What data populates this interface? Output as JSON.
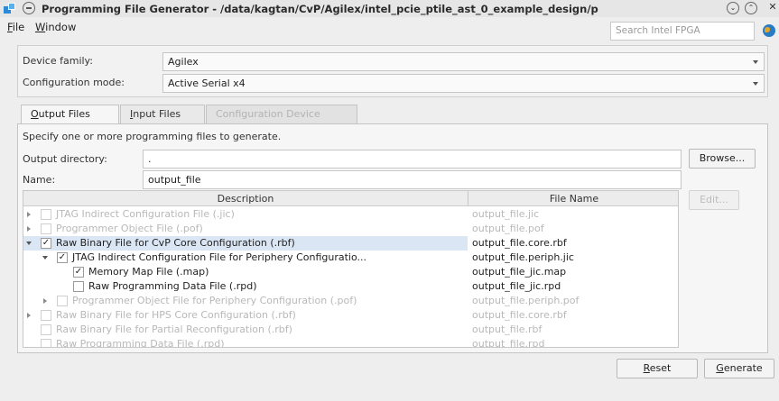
{
  "window": {
    "title": "Programming File Generator - /data/kagtan/CvP/Agilex/intel_pcie_ptile_ast_0_example_design/p",
    "menu_button_icon": "window-menu-icon",
    "minimize_glyph": "⌄",
    "maximize_glyph": "⌃",
    "close_glyph": "✕"
  },
  "menubar": {
    "file": "File",
    "window": "Window",
    "search_placeholder": "Search Intel FPGA"
  },
  "device": {
    "family_label": "Device family:",
    "family_value": "Agilex",
    "config_mode_label": "Configuration mode:",
    "config_mode_value": "Active Serial x4"
  },
  "tabs": [
    {
      "label": "Output Files",
      "mnemonic": "O",
      "rest": "utput Files"
    },
    {
      "label": "Input Files",
      "mnemonic": "I",
      "rest": "nput Files"
    },
    {
      "label": "Configuration Device"
    }
  ],
  "output": {
    "instruction": "Specify one or more programming files to generate.",
    "directory_label": "Output directory:",
    "directory_value": ".",
    "browse_label": "Browse...",
    "name_label": "Name:",
    "name_value": "output_file",
    "edit_label": "Edit..."
  },
  "table": {
    "columns": [
      "Description",
      "File Name"
    ],
    "rows": [
      {
        "description": "JTAG Indirect Configuration File (.jic)",
        "file": "output_file.jic",
        "checked": false,
        "enabled": false,
        "expander": "collapsed",
        "level": 0
      },
      {
        "description": "Programmer Object File (.pof)",
        "file": "output_file.pof",
        "checked": false,
        "enabled": false,
        "expander": "collapsed",
        "level": 0
      },
      {
        "description": "Raw Binary File for CvP Core Configuration (.rbf)",
        "file": "output_file.core.rbf",
        "checked": true,
        "enabled": true,
        "expander": "expanded",
        "level": 0,
        "selected": true
      },
      {
        "description": "JTAG Indirect Configuration File for Periphery Configuratio...",
        "file": "output_file.periph.jic",
        "checked": true,
        "enabled": true,
        "expander": "expanded",
        "level": 1
      },
      {
        "description": "Memory Map File (.map)",
        "file": "output_file_jic.map",
        "checked": true,
        "enabled": true,
        "expander": "none",
        "level": 2
      },
      {
        "description": "Raw Programming Data File (.rpd)",
        "file": "output_file_jic.rpd",
        "checked": false,
        "enabled": true,
        "expander": "none",
        "level": 2
      },
      {
        "description": "Programmer Object File for Periphery Configuration (.pof)",
        "file": "output_file.periph.pof",
        "checked": false,
        "enabled": false,
        "expander": "collapsed",
        "level": 1
      },
      {
        "description": "Raw Binary File for HPS Core Configuration (.rbf)",
        "file": "output_file.core.rbf",
        "checked": false,
        "enabled": false,
        "expander": "collapsed",
        "level": 0
      },
      {
        "description": "Raw Binary File for Partial Reconfiguration (.rbf)",
        "file": "output_file.rbf",
        "checked": false,
        "enabled": false,
        "expander": "none",
        "level": 0
      },
      {
        "description": "Raw Programming Data File (.rpd)",
        "file": "output_file.rpd",
        "checked": false,
        "enabled": false,
        "expander": "none",
        "level": 0
      }
    ]
  },
  "footer": {
    "reset": "Reset",
    "generate": "Generate"
  }
}
